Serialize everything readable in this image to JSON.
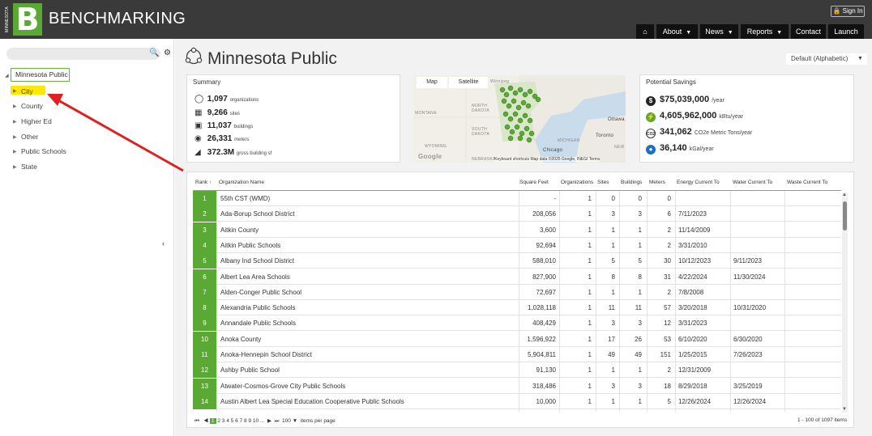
{
  "header": {
    "logo_side_text": "MINNESOTA",
    "logo_mark": "B",
    "brand": "BENCHMARKING",
    "signin_label": "Sign In",
    "nav": {
      "home_icon": "home-icon",
      "about": "About",
      "news": "News",
      "reports": "Reports",
      "contact": "Contact",
      "launch": "Launch"
    }
  },
  "sidebar": {
    "root": "Minnesota Public",
    "items": [
      "City",
      "County",
      "Higher Ed",
      "Other",
      "Public Schools",
      "State"
    ]
  },
  "page": {
    "title": "Minnesota Public",
    "sort_select": "Default (Alphabetic)"
  },
  "summary": {
    "title": "Summary",
    "rows": [
      {
        "value": "1,097",
        "unit": "organizations"
      },
      {
        "value": "9,266",
        "unit": "sites"
      },
      {
        "value": "11,037",
        "unit": "buildings"
      },
      {
        "value": "26,331",
        "unit": "meters"
      },
      {
        "value": "372.3M",
        "unit": "gross building sf"
      }
    ]
  },
  "map": {
    "map_btn": "Map",
    "satellite_btn": "Satellite",
    "labels": [
      "NORTH",
      "DAKOTA",
      "SOUTH",
      "DAKOTA",
      "MONTANA",
      "WYOMING",
      "NEBRASKA",
      "MICHIGAN",
      "Ottawa",
      "Toronto",
      "Chicago",
      "NEW",
      "Google",
      "Winnipeg"
    ],
    "credit": "Keyboard shortcuts   Map data ©2025 Google, INEGI   Terms"
  },
  "savings": {
    "title": "Potential Savings",
    "rows": [
      {
        "value": "$75,039,000",
        "unit": "/year"
      },
      {
        "value": "4,605,962,000",
        "unit": "kBtu/year"
      },
      {
        "value": "341,062",
        "unit": "CO2e Metric Tons/year"
      },
      {
        "value": "36,140",
        "unit": "kGal/year"
      }
    ]
  },
  "table": {
    "columns": [
      "Rank",
      "Organization Name",
      "Square Feet",
      "Organizations",
      "Sites",
      "Buildings",
      "Meters",
      "Energy Current To",
      "Water Current To",
      "Waste Current To"
    ],
    "rows": [
      {
        "rank": "1",
        "name": "55th CST (WMD)",
        "sqft": "-",
        "orgs": "1",
        "sites": "0",
        "bldgs": "0",
        "meters": "0",
        "energy": "",
        "water": ""
      },
      {
        "rank": "2",
        "name": "Ada-Borup School District",
        "sqft": "208,056",
        "orgs": "1",
        "sites": "3",
        "bldgs": "3",
        "meters": "6",
        "energy": "7/11/2023",
        "water": ""
      },
      {
        "rank": "3",
        "name": "Aitkin County",
        "sqft": "3,600",
        "orgs": "1",
        "sites": "1",
        "bldgs": "1",
        "meters": "2",
        "energy": "11/14/2009",
        "water": ""
      },
      {
        "rank": "4",
        "name": "Aitkin Public Schools",
        "sqft": "92,694",
        "orgs": "1",
        "sites": "1",
        "bldgs": "1",
        "meters": "2",
        "energy": "3/31/2010",
        "water": ""
      },
      {
        "rank": "5",
        "name": "Albany Ind School District",
        "sqft": "588,010",
        "orgs": "1",
        "sites": "5",
        "bldgs": "5",
        "meters": "30",
        "energy": "10/12/2023",
        "water": "9/11/2023"
      },
      {
        "rank": "6",
        "name": "Albert Lea Area Schools",
        "sqft": "827,900",
        "orgs": "1",
        "sites": "8",
        "bldgs": "8",
        "meters": "31",
        "energy": "4/22/2024",
        "water": "11/30/2024"
      },
      {
        "rank": "7",
        "name": "Alden-Conger Public School",
        "sqft": "72,697",
        "orgs": "1",
        "sites": "1",
        "bldgs": "1",
        "meters": "2",
        "energy": "7/8/2008",
        "water": ""
      },
      {
        "rank": "8",
        "name": "Alexandria Public Schools",
        "sqft": "1,028,118",
        "orgs": "1",
        "sites": "11",
        "bldgs": "11",
        "meters": "57",
        "energy": "3/20/2018",
        "water": "10/31/2020"
      },
      {
        "rank": "9",
        "name": "Annandale Public Schools",
        "sqft": "408,429",
        "orgs": "1",
        "sites": "3",
        "bldgs": "3",
        "meters": "12",
        "energy": "3/31/2023",
        "water": ""
      },
      {
        "rank": "10",
        "name": "Anoka County",
        "sqft": "1,596,922",
        "orgs": "1",
        "sites": "17",
        "bldgs": "26",
        "meters": "53",
        "energy": "6/10/2020",
        "water": "6/30/2020"
      },
      {
        "rank": "11",
        "name": "Anoka-Hennepin School District",
        "sqft": "5,904,811",
        "orgs": "1",
        "sites": "49",
        "bldgs": "49",
        "meters": "151",
        "energy": "1/25/2015",
        "water": "7/26/2023"
      },
      {
        "rank": "12",
        "name": "Ashby Public School",
        "sqft": "91,130",
        "orgs": "1",
        "sites": "1",
        "bldgs": "1",
        "meters": "2",
        "energy": "12/31/2009",
        "water": ""
      },
      {
        "rank": "13",
        "name": "Atwater-Cosmos-Grove City Public Schools",
        "sqft": "318,486",
        "orgs": "1",
        "sites": "3",
        "bldgs": "3",
        "meters": "18",
        "energy": "8/29/2018",
        "water": "3/25/2019"
      },
      {
        "rank": "14",
        "name": "Austin Albert Lea Special Education Cooperative Public Schools",
        "sqft": "10,000",
        "orgs": "1",
        "sites": "1",
        "bldgs": "1",
        "meters": "5",
        "energy": "12/26/2024",
        "water": "12/26/2024"
      }
    ],
    "pager": {
      "first": "⏮",
      "prev": "◀",
      "pages": [
        "1",
        "2",
        "3",
        "4",
        "5",
        "6",
        "7",
        "8",
        "9",
        "10",
        "..."
      ],
      "next": "▶",
      "last": "⏭",
      "page_size": "100",
      "per_page_label": "items per page",
      "count": "1 - 100 of 1097 items"
    }
  },
  "colors": {
    "brand_green": "#5aa935",
    "topbar": "#3a3a3a",
    "highlight": "#ffe800",
    "annotation_arrow": "#e02020"
  }
}
